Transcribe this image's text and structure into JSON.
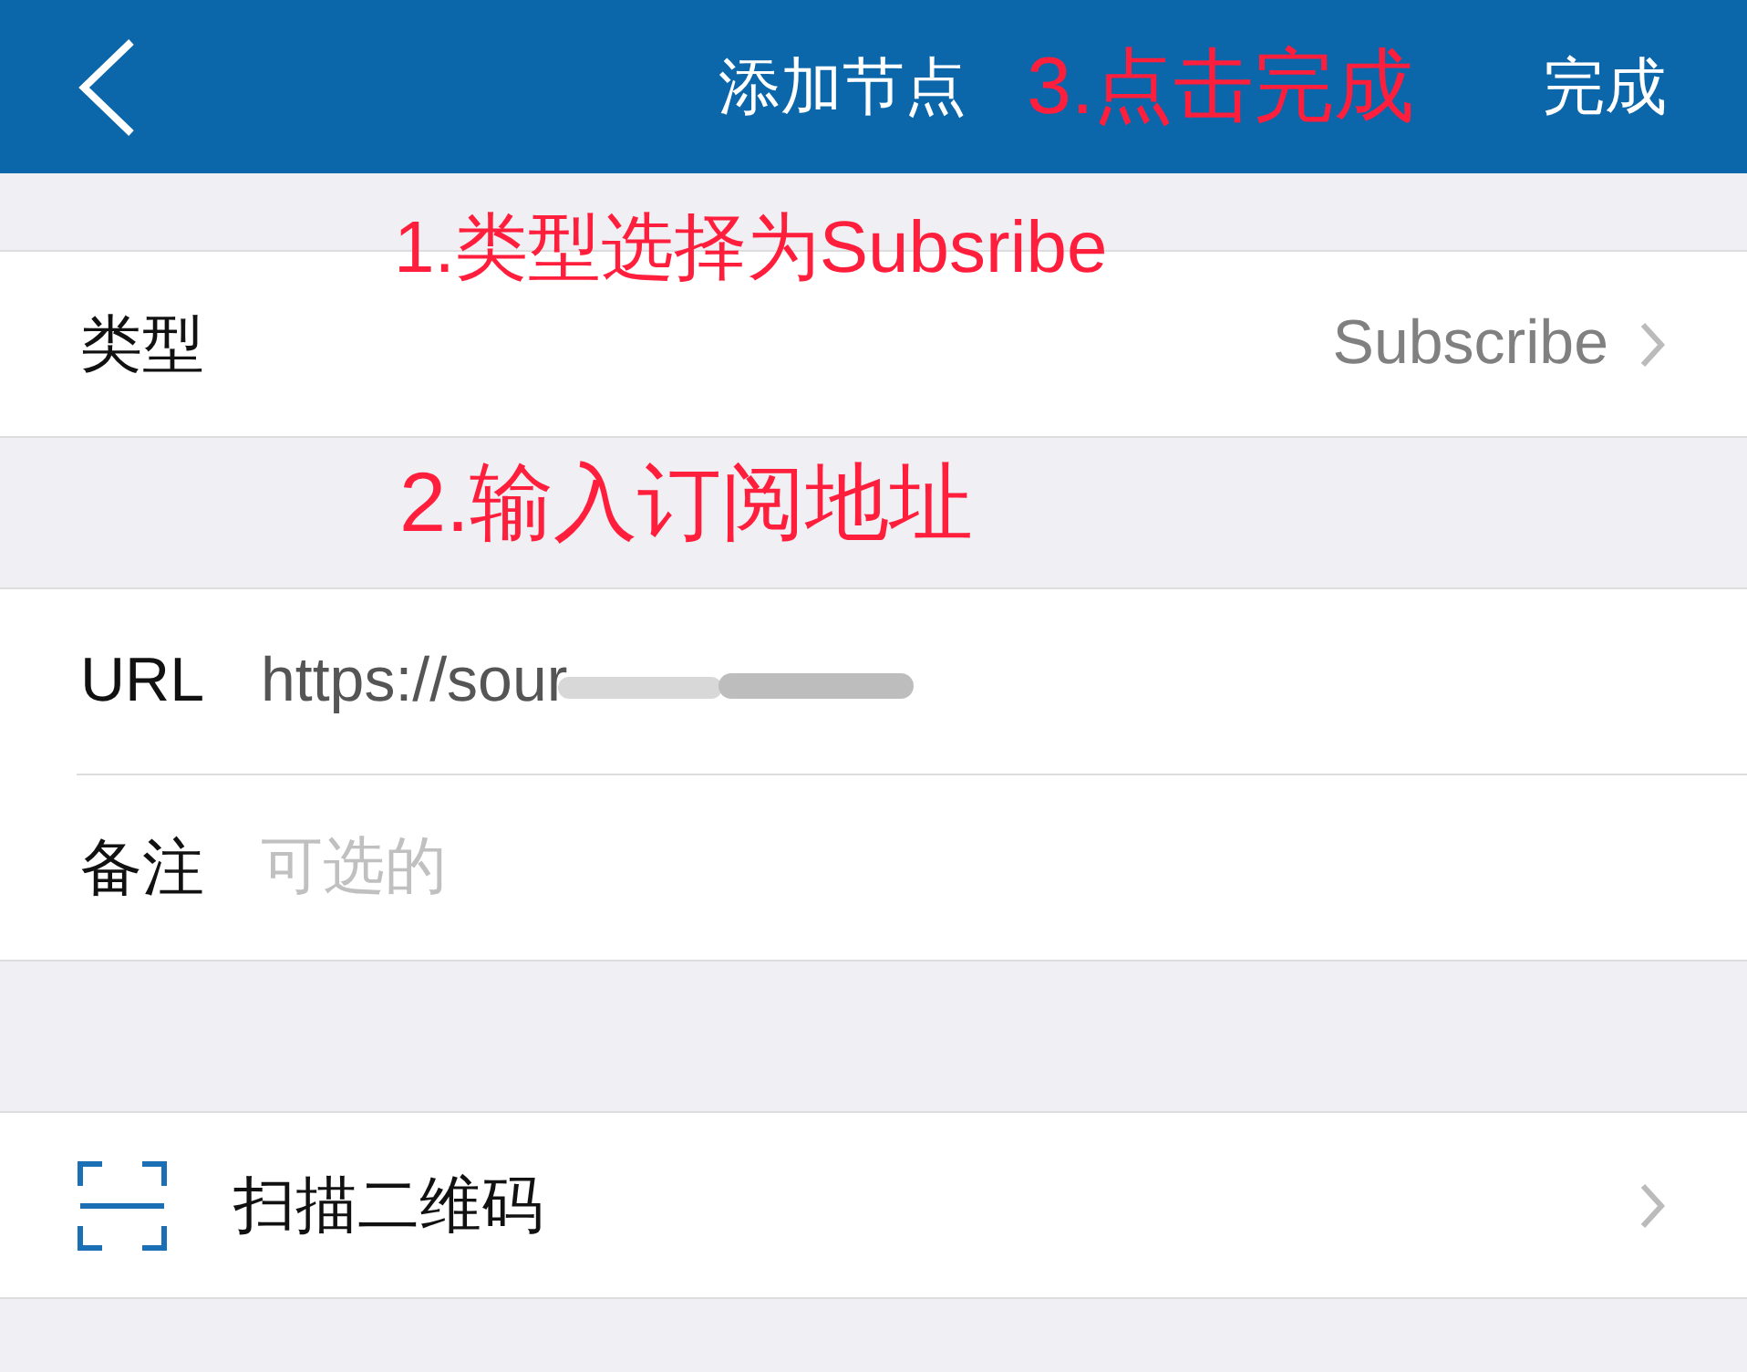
{
  "header": {
    "title": "添加节点",
    "done": "完成"
  },
  "type_row": {
    "label": "类型",
    "value": "Subscribe"
  },
  "fields": [
    {
      "label": "URL",
      "value": "https://sour"
    },
    {
      "label": "备注",
      "placeholder": "可选的"
    }
  ],
  "scan_row": {
    "label": "扫描二维码"
  },
  "annotations": [
    {
      "text": "3.点击完成"
    },
    {
      "text": "1.类型选择为Subsribe"
    },
    {
      "text": "2.输入订阅地址"
    }
  ]
}
